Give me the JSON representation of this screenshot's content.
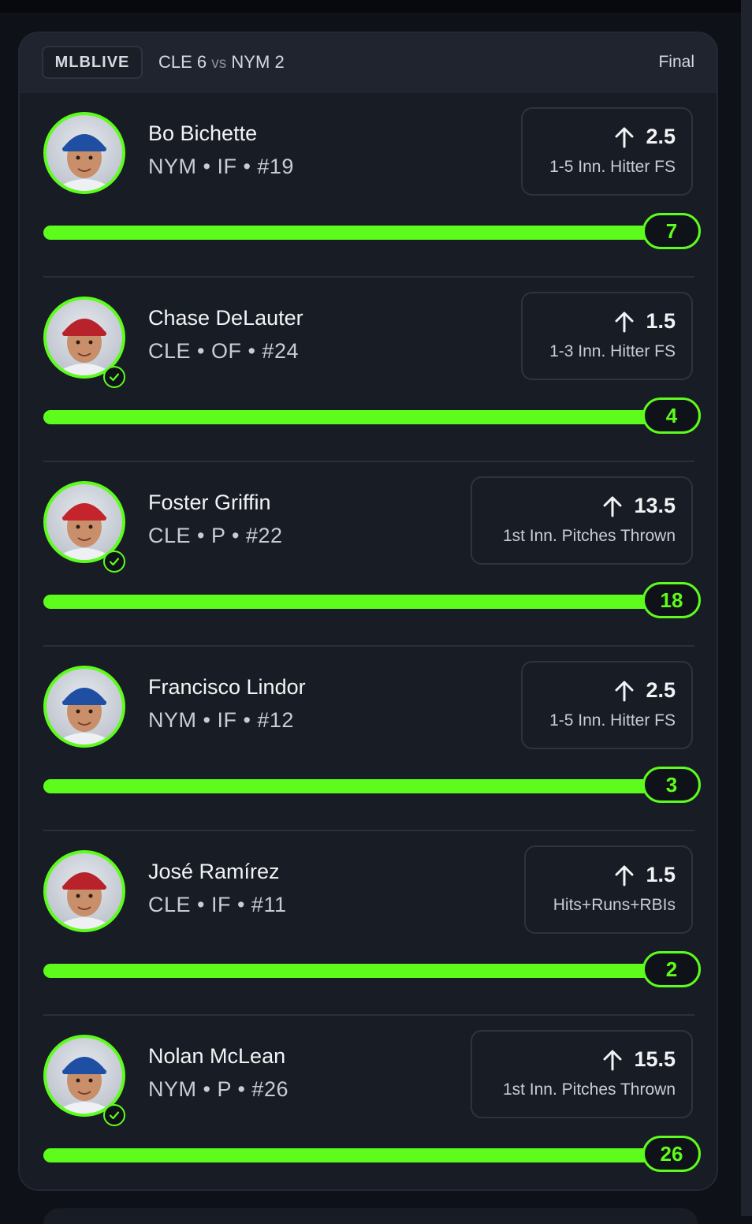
{
  "header": {
    "league": "MLBLIVE",
    "team_a": "CLE",
    "score_a": "6",
    "vs": "vs",
    "team_b": "NYM",
    "score_b": "2",
    "status": "Final"
  },
  "colors": {
    "accent": "#5dfc1d",
    "background": "#0e1118",
    "card": "#181c25"
  },
  "players": [
    {
      "name": "Bo Bichette",
      "info": "NYM • IF • #19",
      "line": "2.5",
      "prop_type": "1-5 Inn. Hitter FS",
      "result": "7",
      "progress": 1.0,
      "checked": false,
      "cap": "#1f4fa3"
    },
    {
      "name": "Chase DeLauter",
      "info": "CLE • OF • #24",
      "line": "1.5",
      "prop_type": "1-3 Inn. Hitter FS",
      "result": "4",
      "progress": 1.0,
      "checked": true,
      "cap": "#b8222b"
    },
    {
      "name": "Foster Griffin",
      "info": "CLE • P • #22",
      "line": "13.5",
      "prop_type": "1st Inn. Pitches Thrown",
      "result": "18",
      "progress": 1.0,
      "checked": true,
      "cap": "#c4242c"
    },
    {
      "name": "Francisco Lindor",
      "info": "NYM • IF • #12",
      "line": "2.5",
      "prop_type": "1-5 Inn. Hitter FS",
      "result": "3",
      "progress": 1.0,
      "checked": false,
      "cap": "#1f4fa3"
    },
    {
      "name": "José Ramírez",
      "info": "CLE • IF • #11",
      "line": "1.5",
      "prop_type": "Hits+Runs+RBIs",
      "result": "2",
      "progress": 1.0,
      "checked": false,
      "cap": "#b8222b"
    },
    {
      "name": "Nolan McLean",
      "info": "NYM • P • #26",
      "line": "15.5",
      "prop_type": "1st Inn. Pitches Thrown",
      "result": "26",
      "progress": 1.0,
      "checked": true,
      "cap": "#1f4fa3"
    }
  ]
}
